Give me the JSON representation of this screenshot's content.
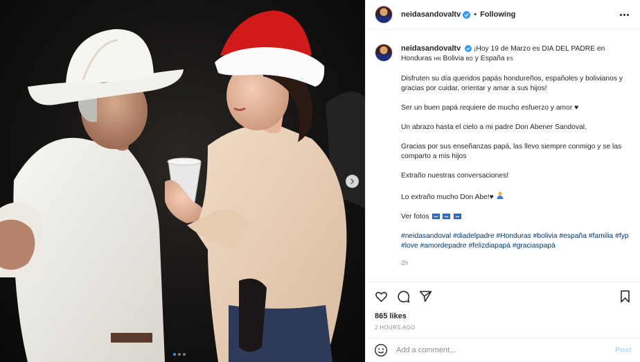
{
  "post": {
    "username": "neidasandovaltv",
    "follow_status": "Following",
    "bullet": "•",
    "photo_alt": "Photo of an elderly man in a white cowboy hat and a woman in a Santa hat holding a cup",
    "carousel": {
      "count": 3,
      "active": 1
    }
  },
  "caption": {
    "line1": "¡Hoy 19 de Marzo es DIA DEL PADRE en Honduras ",
    "flag_hn": "HN",
    "bolivia": " Bolivia ",
    "flag_bo": "BO",
    "y_espana": " y España ",
    "flag_es": "ES",
    "p2": "Disfruten su día queridos papás hondureños, españoles y bolivianos y gracias por cuidar, orientar y amar a sus hijos!",
    "p3": "Ser un buen papá requiere de mucho esfuerzo y amor ♥",
    "p4": "Un abrazo hasta el cielo a mi padre Don Abener Sandoval.",
    "p5": "Gracias por sus enseñanzas papá, las llevo siempre conmigo y se las comparto a mis hijos",
    "p6": "Extraño nuestras conversaciones!",
    "p7": "Lo extraño mucho Don Abe!♥",
    "p8": "Ver fotos",
    "hashtags": "#neidasandoval #diadelpadre #Honduras #bolivia #españa #familia #fyp #love #amordepadre #felizdiapapá #graciaspapá",
    "time": "2h"
  },
  "engagement": {
    "likes": "865 likes",
    "date": "2 HOURS AGO"
  },
  "comment": {
    "placeholder": "Add a comment...",
    "post_label": "Post"
  },
  "icons": {
    "like": "heart-icon",
    "comment": "comment-icon",
    "share": "share-icon",
    "save": "bookmark-icon",
    "emoji": "emoji-icon",
    "verified": "verified-badge-icon",
    "more": "more-options-icon",
    "next": "chevron-right-icon"
  },
  "colors": {
    "verified": "#3897f0",
    "link": "#00376b",
    "muted": "#8e8e8e",
    "post_disabled": "#b2dffc",
    "hat_red": "#d11a1a"
  }
}
